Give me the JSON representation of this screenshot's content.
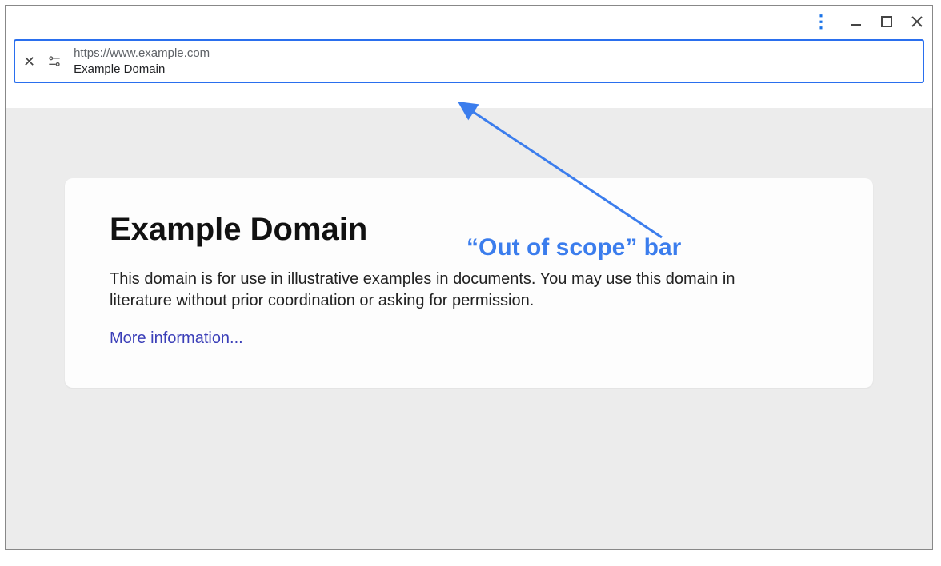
{
  "address_bar": {
    "url": "https://www.example.com",
    "title": "Example Domain"
  },
  "page": {
    "heading": "Example Domain",
    "body": "This domain is for use in illustrative examples in documents. You may use this domain in literature without prior coordination or asking for permission.",
    "link_label": "More information..."
  },
  "annotation": {
    "label": "“Out of scope” bar"
  }
}
